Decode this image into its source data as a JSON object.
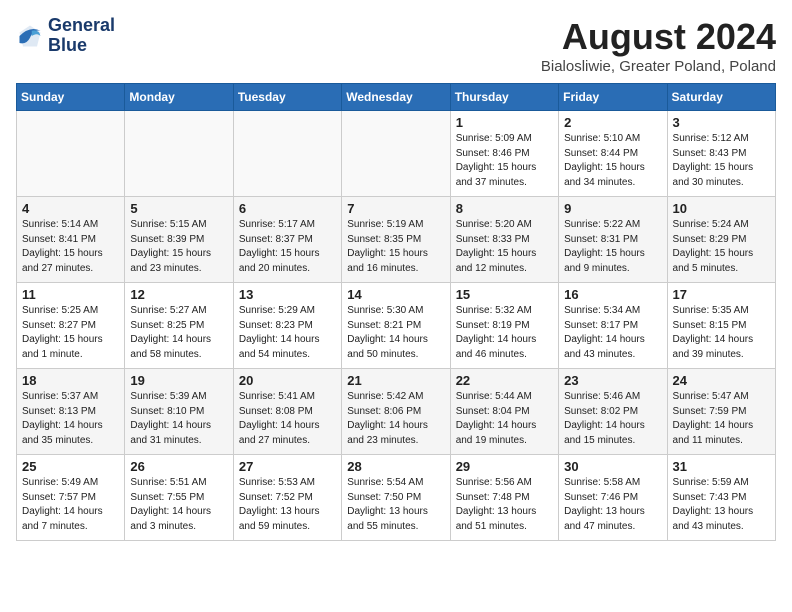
{
  "header": {
    "logo_line1": "General",
    "logo_line2": "Blue",
    "month": "August 2024",
    "location": "Bialosliwie, Greater Poland, Poland"
  },
  "weekdays": [
    "Sunday",
    "Monday",
    "Tuesday",
    "Wednesday",
    "Thursday",
    "Friday",
    "Saturday"
  ],
  "weeks": [
    [
      {
        "day": "",
        "info": ""
      },
      {
        "day": "",
        "info": ""
      },
      {
        "day": "",
        "info": ""
      },
      {
        "day": "",
        "info": ""
      },
      {
        "day": "1",
        "info": "Sunrise: 5:09 AM\nSunset: 8:46 PM\nDaylight: 15 hours\nand 37 minutes."
      },
      {
        "day": "2",
        "info": "Sunrise: 5:10 AM\nSunset: 8:44 PM\nDaylight: 15 hours\nand 34 minutes."
      },
      {
        "day": "3",
        "info": "Sunrise: 5:12 AM\nSunset: 8:43 PM\nDaylight: 15 hours\nand 30 minutes."
      }
    ],
    [
      {
        "day": "4",
        "info": "Sunrise: 5:14 AM\nSunset: 8:41 PM\nDaylight: 15 hours\nand 27 minutes."
      },
      {
        "day": "5",
        "info": "Sunrise: 5:15 AM\nSunset: 8:39 PM\nDaylight: 15 hours\nand 23 minutes."
      },
      {
        "day": "6",
        "info": "Sunrise: 5:17 AM\nSunset: 8:37 PM\nDaylight: 15 hours\nand 20 minutes."
      },
      {
        "day": "7",
        "info": "Sunrise: 5:19 AM\nSunset: 8:35 PM\nDaylight: 15 hours\nand 16 minutes."
      },
      {
        "day": "8",
        "info": "Sunrise: 5:20 AM\nSunset: 8:33 PM\nDaylight: 15 hours\nand 12 minutes."
      },
      {
        "day": "9",
        "info": "Sunrise: 5:22 AM\nSunset: 8:31 PM\nDaylight: 15 hours\nand 9 minutes."
      },
      {
        "day": "10",
        "info": "Sunrise: 5:24 AM\nSunset: 8:29 PM\nDaylight: 15 hours\nand 5 minutes."
      }
    ],
    [
      {
        "day": "11",
        "info": "Sunrise: 5:25 AM\nSunset: 8:27 PM\nDaylight: 15 hours\nand 1 minute."
      },
      {
        "day": "12",
        "info": "Sunrise: 5:27 AM\nSunset: 8:25 PM\nDaylight: 14 hours\nand 58 minutes."
      },
      {
        "day": "13",
        "info": "Sunrise: 5:29 AM\nSunset: 8:23 PM\nDaylight: 14 hours\nand 54 minutes."
      },
      {
        "day": "14",
        "info": "Sunrise: 5:30 AM\nSunset: 8:21 PM\nDaylight: 14 hours\nand 50 minutes."
      },
      {
        "day": "15",
        "info": "Sunrise: 5:32 AM\nSunset: 8:19 PM\nDaylight: 14 hours\nand 46 minutes."
      },
      {
        "day": "16",
        "info": "Sunrise: 5:34 AM\nSunset: 8:17 PM\nDaylight: 14 hours\nand 43 minutes."
      },
      {
        "day": "17",
        "info": "Sunrise: 5:35 AM\nSunset: 8:15 PM\nDaylight: 14 hours\nand 39 minutes."
      }
    ],
    [
      {
        "day": "18",
        "info": "Sunrise: 5:37 AM\nSunset: 8:13 PM\nDaylight: 14 hours\nand 35 minutes."
      },
      {
        "day": "19",
        "info": "Sunrise: 5:39 AM\nSunset: 8:10 PM\nDaylight: 14 hours\nand 31 minutes."
      },
      {
        "day": "20",
        "info": "Sunrise: 5:41 AM\nSunset: 8:08 PM\nDaylight: 14 hours\nand 27 minutes."
      },
      {
        "day": "21",
        "info": "Sunrise: 5:42 AM\nSunset: 8:06 PM\nDaylight: 14 hours\nand 23 minutes."
      },
      {
        "day": "22",
        "info": "Sunrise: 5:44 AM\nSunset: 8:04 PM\nDaylight: 14 hours\nand 19 minutes."
      },
      {
        "day": "23",
        "info": "Sunrise: 5:46 AM\nSunset: 8:02 PM\nDaylight: 14 hours\nand 15 minutes."
      },
      {
        "day": "24",
        "info": "Sunrise: 5:47 AM\nSunset: 7:59 PM\nDaylight: 14 hours\nand 11 minutes."
      }
    ],
    [
      {
        "day": "25",
        "info": "Sunrise: 5:49 AM\nSunset: 7:57 PM\nDaylight: 14 hours\nand 7 minutes."
      },
      {
        "day": "26",
        "info": "Sunrise: 5:51 AM\nSunset: 7:55 PM\nDaylight: 14 hours\nand 3 minutes."
      },
      {
        "day": "27",
        "info": "Sunrise: 5:53 AM\nSunset: 7:52 PM\nDaylight: 13 hours\nand 59 minutes."
      },
      {
        "day": "28",
        "info": "Sunrise: 5:54 AM\nSunset: 7:50 PM\nDaylight: 13 hours\nand 55 minutes."
      },
      {
        "day": "29",
        "info": "Sunrise: 5:56 AM\nSunset: 7:48 PM\nDaylight: 13 hours\nand 51 minutes."
      },
      {
        "day": "30",
        "info": "Sunrise: 5:58 AM\nSunset: 7:46 PM\nDaylight: 13 hours\nand 47 minutes."
      },
      {
        "day": "31",
        "info": "Sunrise: 5:59 AM\nSunset: 7:43 PM\nDaylight: 13 hours\nand 43 minutes."
      }
    ]
  ]
}
